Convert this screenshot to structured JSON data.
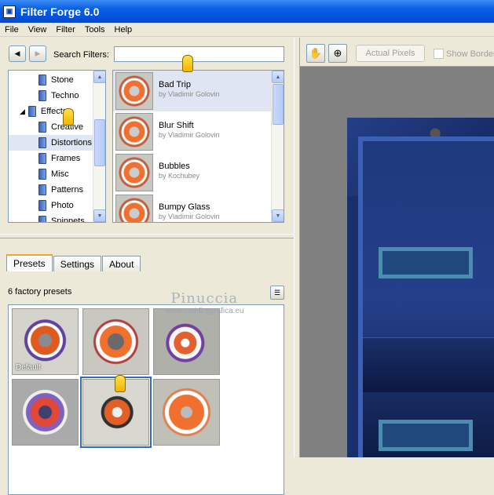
{
  "window": {
    "title": "Filter Forge 6.0",
    "icon": "app-icon"
  },
  "menu": [
    "File",
    "View",
    "Filter",
    "Tools",
    "Help"
  ],
  "search": {
    "label": "Search Filters:",
    "value": ""
  },
  "tree": {
    "items": [
      {
        "label": "Stone",
        "indent": 1,
        "selected": false
      },
      {
        "label": "Techno",
        "indent": 1,
        "selected": false
      },
      {
        "label": "Effects",
        "indent": 0,
        "selected": false
      },
      {
        "label": "Creative",
        "indent": 1,
        "selected": false
      },
      {
        "label": "Distortions",
        "indent": 1,
        "selected": true
      },
      {
        "label": "Frames",
        "indent": 1,
        "selected": false
      },
      {
        "label": "Misc",
        "indent": 1,
        "selected": false
      },
      {
        "label": "Patterns",
        "indent": 1,
        "selected": false
      },
      {
        "label": "Photo",
        "indent": 1,
        "selected": false
      },
      {
        "label": "Snippets",
        "indent": 1,
        "selected": false
      }
    ]
  },
  "filters": [
    {
      "name": "Bad Trip",
      "author": "by Vladimir Golovin",
      "selected": true
    },
    {
      "name": "Blur Shift",
      "author": "by Vladimir Golovin",
      "selected": false
    },
    {
      "name": "Bubbles",
      "author": "by Kochubey",
      "selected": false
    },
    {
      "name": "Bumpy Glass",
      "author": "by Vladimir Golovin",
      "selected": false
    }
  ],
  "tabs": [
    {
      "label": "Presets",
      "active": true
    },
    {
      "label": "Settings",
      "active": false
    },
    {
      "label": "About",
      "active": false
    }
  ],
  "presets": {
    "count_text": "6 factory presets",
    "items": [
      {
        "label": "Default",
        "selected": false
      },
      {
        "label": "",
        "selected": false
      },
      {
        "label": "",
        "selected": false
      },
      {
        "label": "",
        "selected": false
      },
      {
        "label": "",
        "selected": true
      },
      {
        "label": "",
        "selected": false
      }
    ]
  },
  "toolbar": {
    "hand_icon": "hand-tool-icon",
    "zoom_icon": "zoom-tool-icon",
    "actual_pixels": "Actual Pixels",
    "show_border": "Show Border",
    "show_border_checked": false
  },
  "watermark": {
    "line1": "Pinuccia",
    "line2": "www.maidiregrafica.eu"
  }
}
